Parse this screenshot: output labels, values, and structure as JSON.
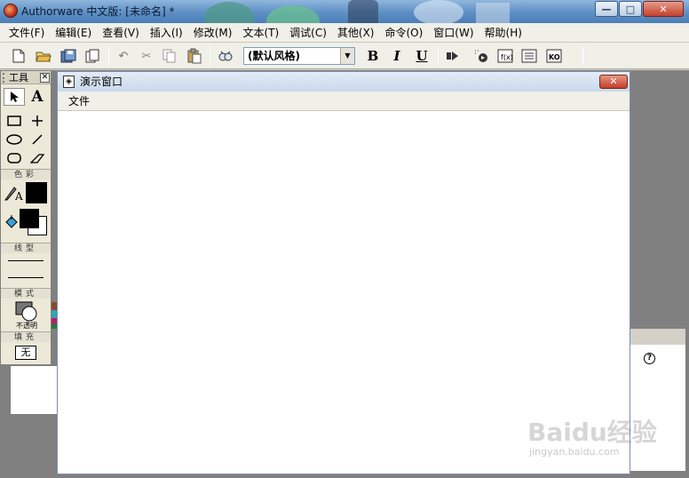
{
  "window": {
    "title": "Authorware 中文版: [未命名] *",
    "controls": {
      "minimize": "—",
      "maximize": "□",
      "close": "✕"
    }
  },
  "menubar": {
    "items": [
      "文件(F)",
      "编辑(E)",
      "查看(V)",
      "插入(I)",
      "修改(M)",
      "文本(T)",
      "调试(C)",
      "其他(X)",
      "命令(O)",
      "窗口(W)",
      "帮助(H)"
    ]
  },
  "toolbar": {
    "style_combo": "(默认风格)",
    "bold": "B",
    "italic": "I",
    "underline": "U",
    "icons": [
      "new-file-icon",
      "open-folder-icon",
      "save-all-icon",
      "import-icon",
      "undo-icon",
      "cut-icon",
      "copy-icon",
      "paste-icon",
      "find-icon",
      "run-icon",
      "control-panel-icon",
      "functions-icon",
      "variables-icon",
      "knowledge-objects-icon"
    ]
  },
  "presentation_window": {
    "title": "演示窗口",
    "menu_file": "文件",
    "close": "✕"
  },
  "tools": {
    "title": "工具",
    "close": "✕",
    "sections": {
      "color": "色彩",
      "line": "线型",
      "mode": "模式",
      "fill": "填充"
    },
    "mode_value": "不透明",
    "fill_value": "无",
    "text_tool": "A"
  },
  "help": {
    "icon": "?"
  },
  "watermark": {
    "logo": "Baidu经验",
    "url": "jingyan.baidu.com"
  }
}
